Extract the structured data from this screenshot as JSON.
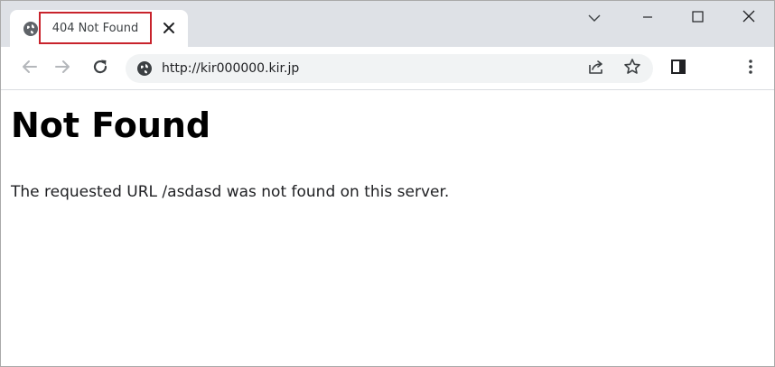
{
  "tab": {
    "title": "404 Not Found",
    "favicon": "globe-icon",
    "close_icon": "close-icon"
  },
  "window_controls": {
    "tab_search": "chevron-down-icon",
    "minimize": "minimize-icon",
    "maximize": "maximize-icon",
    "close": "close-icon"
  },
  "toolbar": {
    "back": "arrow-left-icon",
    "forward": "arrow-right-icon",
    "reload": "reload-icon",
    "side_panel": "side-panel-icon",
    "menu": "more-vertical-icon"
  },
  "omnibox": {
    "site_icon": "globe-icon",
    "url": "http://kir000000.kir.jp",
    "share": "share-icon",
    "bookmark": "star-icon"
  },
  "page": {
    "heading": "Not Found",
    "message": "The requested URL /asdasd was not found on this server."
  },
  "colors": {
    "tabstrip_bg": "#dee1e6",
    "omnibox_bg": "#f1f3f4",
    "highlight_border": "#c8232c",
    "icon_color": "#5f6368",
    "disabled_icon": "#b4b7bb"
  }
}
